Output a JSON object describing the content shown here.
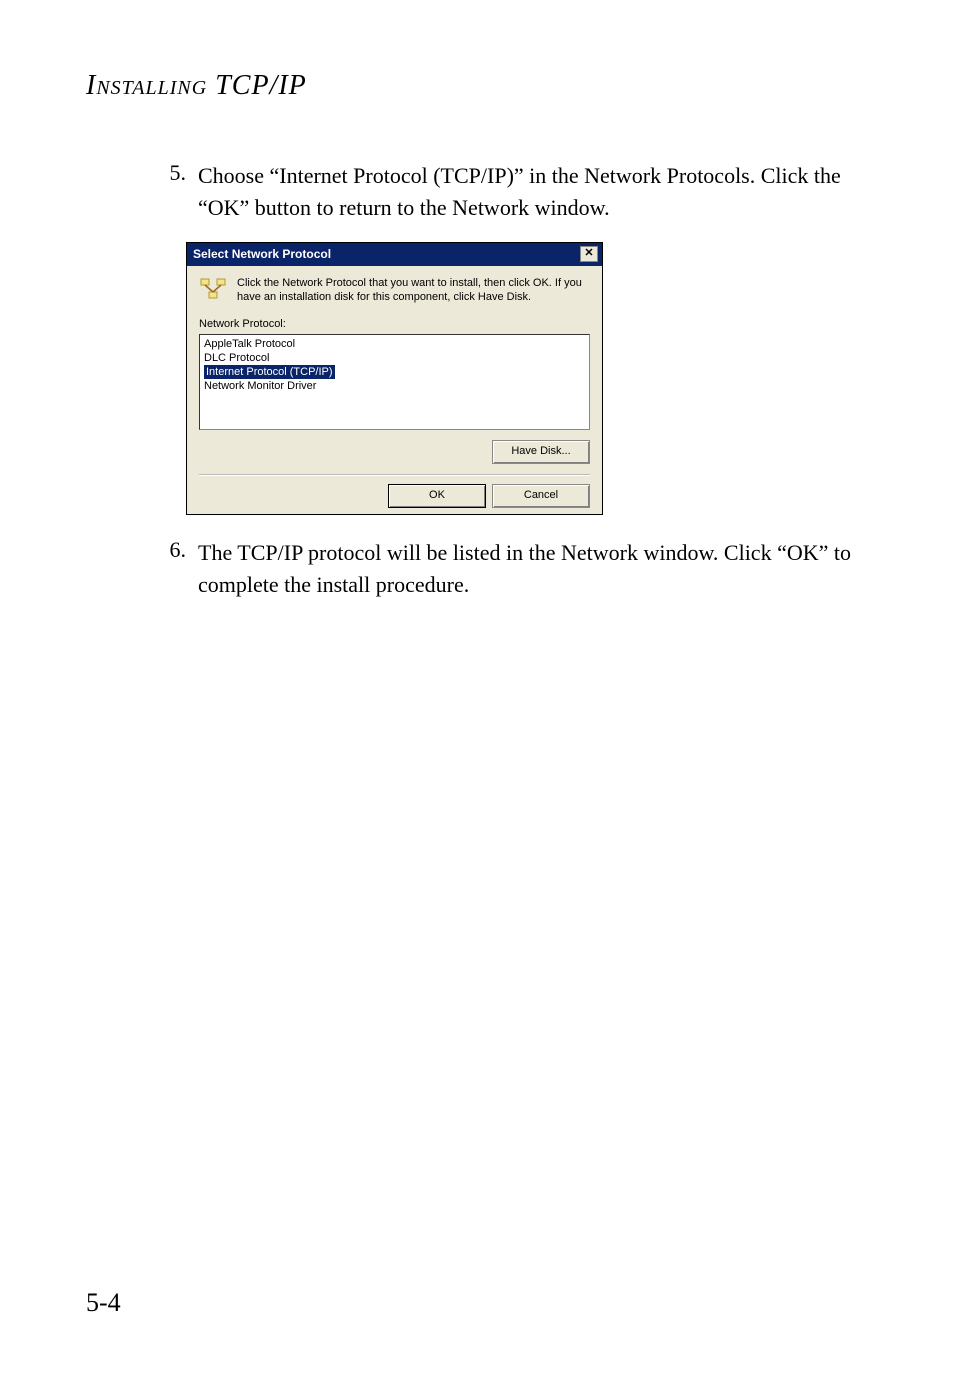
{
  "page": {
    "header": "Installing TCP/IP",
    "footer": "5-4"
  },
  "steps": {
    "s5_num": "5.",
    "s5_text": "Choose “Internet Protocol (TCP/IP)” in the Network Protocols. Click the “OK” button to return to the Network window.",
    "s6_num": "6.",
    "s6_text": "The TCP/IP protocol will be listed in the Network window. Click “OK” to complete the install procedure."
  },
  "dialog": {
    "title": "Select Network Protocol",
    "close_glyph": "✕",
    "instruction": "Click the Network Protocol that you want to install, then click OK. If you have an installation disk for this component, click Have Disk.",
    "list_label": "Network Protocol:",
    "options": {
      "o0": "AppleTalk Protocol",
      "o1": "DLC Protocol",
      "o2": "Internet Protocol (TCP/IP)",
      "o3": "Network Monitor Driver"
    },
    "have_disk": "Have Disk...",
    "ok": "OK",
    "cancel": "Cancel"
  }
}
